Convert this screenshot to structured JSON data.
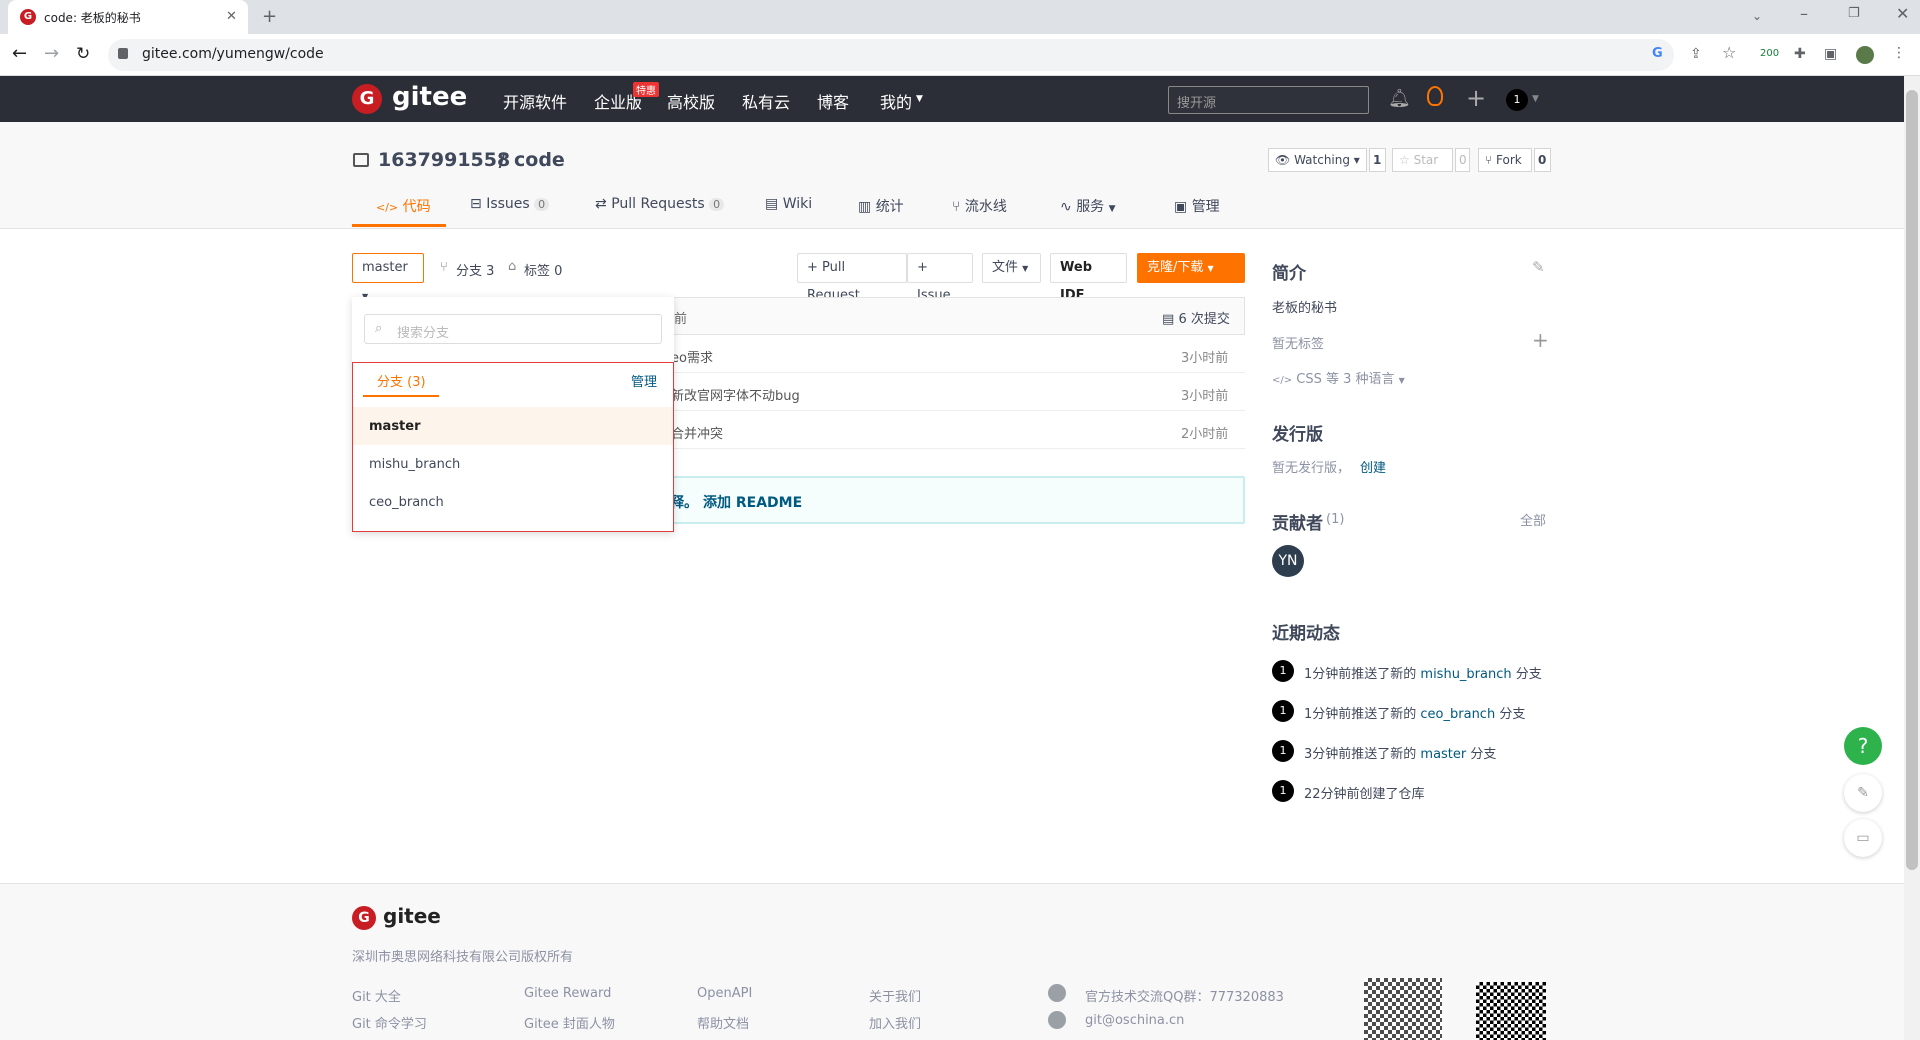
{
  "browser": {
    "tab_title": "code: 老板的秘书",
    "url": "gitee.com/yumengw/code",
    "ext_badge": "200"
  },
  "nav": {
    "logo": "gitee",
    "items": [
      "开源软件",
      "企业版",
      "高校版",
      "私有云",
      "博客",
      "我的"
    ],
    "badge": "特惠",
    "search_placeholder": "搜开源",
    "user_initial": "1"
  },
  "repo": {
    "owner": "1637991558",
    "sep": " / ",
    "name": "code",
    "watch_label": "Watching",
    "watch_count": "1",
    "star_label": "Star",
    "star_count": "0",
    "fork_label": "Fork",
    "fork_count": "0",
    "tabs": [
      {
        "label": "代码",
        "icon": "</>"
      },
      {
        "label": "Issues",
        "count": "0"
      },
      {
        "label": "Pull Requests",
        "count": "0"
      },
      {
        "label": "Wiki"
      },
      {
        "label": "统计"
      },
      {
        "label": "流水线"
      },
      {
        "label": "服务"
      },
      {
        "label": "管理"
      }
    ]
  },
  "toolbar": {
    "branch": "master",
    "branches_label": "分支 3",
    "tags_label": "标签 0",
    "pr_button": "+ Pull Request",
    "issue_button": "+ Issue",
    "file_button": "文件",
    "webide_button": "Web IDE",
    "clone_button": "克隆/下载"
  },
  "dropdown": {
    "search_placeholder": "搜索分支",
    "tab_label": "分支 (3)",
    "manage": "管理",
    "branches": [
      "master",
      "mishu_branch",
      "ceo_branch"
    ]
  },
  "commits": {
    "header_partial": "前",
    "count_label": "6 次提交",
    "rows": [
      {
        "msg": "eo需求",
        "time": "3小时前"
      },
      {
        "msg": "新改官网字体不动bug",
        "time": "3小时前"
      },
      {
        "msg": "合并冲突",
        "time": "2小时前"
      }
    ]
  },
  "readme": {
    "partial": "释。",
    "add_label": "添加 README"
  },
  "sidebar": {
    "intro_title": "简介",
    "description": "老板的秘书",
    "no_tags": "暂无标签",
    "languages": "CSS 等 3 种语言",
    "release_title": "发行版",
    "no_release": "暂无发行版，",
    "create": "创建",
    "contrib_title": "贡献者",
    "contrib_count": "(1)",
    "all": "全部",
    "contrib_avatar": "YN",
    "activity_title": "近期动态",
    "activity": [
      {
        "pre": "1分钟前推送了新的 ",
        "link": "mishu_branch",
        "post": " 分支"
      },
      {
        "pre": "1分钟前推送了新的 ",
        "link": "ceo_branch",
        "post": " 分支"
      },
      {
        "pre": "3分钟前推送了新的 ",
        "link": "master",
        "post": " 分支"
      },
      {
        "pre": "22分钟前创建了仓库",
        "link": "",
        "post": ""
      }
    ]
  },
  "footer": {
    "logo": "gitee",
    "copyright": "深圳市奥思网络科技有限公司版权所有",
    "col1": [
      "Git 大全",
      "Git 命令学习"
    ],
    "col2": [
      "Gitee Reward",
      "Gitee 封面人物"
    ],
    "col3": [
      "OpenAPI",
      "帮助文档"
    ],
    "col4": [
      "关于我们",
      "加入我们"
    ],
    "qq": "官方技术交流QQ群：777320883",
    "email": "git@oschina.cn"
  },
  "colors": {
    "nav_bg": "#2b2e36",
    "accent": "#fe7300",
    "link": "#005980",
    "highlight_border": "#e63b3b"
  }
}
